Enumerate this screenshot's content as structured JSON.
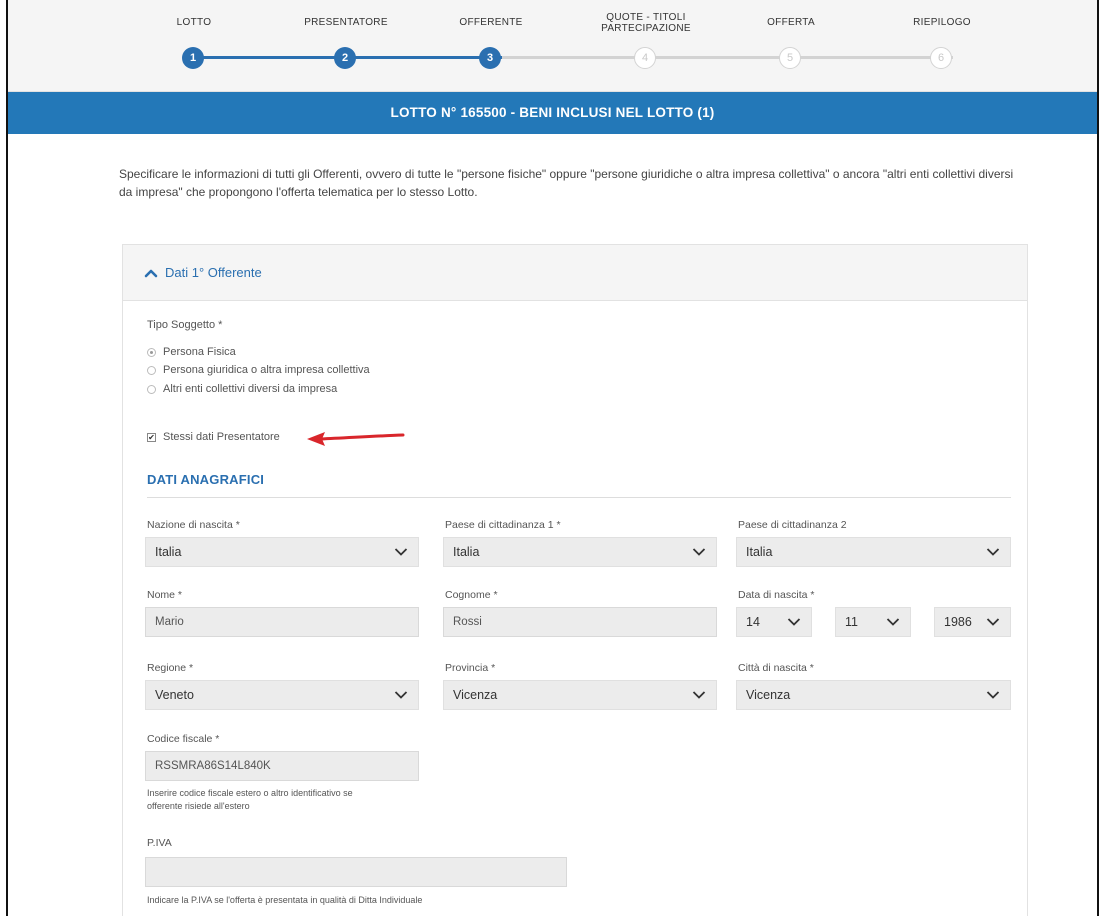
{
  "stepper": {
    "steps": [
      {
        "label": "LOTTO",
        "number": "1",
        "state": "done"
      },
      {
        "label": "PRESENTATORE",
        "number": "2",
        "state": "done"
      },
      {
        "label": "OFFERENTE",
        "number": "3",
        "state": "done"
      },
      {
        "label_line1": "QUOTE - TITOLI",
        "label_line2": "PARTECIPAZIONE",
        "number": "4",
        "state": "todo"
      },
      {
        "label": "OFFERTA",
        "number": "5",
        "state": "todo"
      },
      {
        "label": "RIEPILOGO",
        "number": "6",
        "state": "todo"
      }
    ],
    "active_color": "#2a6fb0",
    "inactive_color": "#d3d3d3"
  },
  "banner": {
    "text": "LOTTO N° 165500  -  BENI INCLUSI NEL LOTTO  (1)",
    "color": "#2378b8"
  },
  "intro": {
    "text": "Specificare le informazioni di tutti gli Offerenti, ovvero di tutte le \"persone fisiche\" oppure \"persone giuridiche o altra impresa collettiva\" o ancora \"altri enti collettivi diversi da impresa\" che propongono l'offerta telematica per lo stesso Lotto."
  },
  "panel": {
    "title": "Dati 1° Offerente",
    "icon": "chevron-up-icon"
  },
  "tipo_soggetto": {
    "label": "Tipo Soggetto *",
    "options": [
      {
        "label": "Persona Fisica",
        "selected": true
      },
      {
        "label": "Persona giuridica o altra impresa collettiva",
        "selected": false
      },
      {
        "label": "Altri enti collettivi diversi da impresa",
        "selected": false
      }
    ]
  },
  "stessi_dati": {
    "label": "Stessi dati Presentatore",
    "checked": true
  },
  "annotation": {
    "icon": "red-arrow-icon",
    "color": "#d9262b"
  },
  "anagrafici": {
    "title": "DATI ANAGRAFICI",
    "nazione_nascita": {
      "label": "Nazione di nascita  *",
      "value": "Italia"
    },
    "paese_cittadinanza_1": {
      "label": "Paese di cittadinanza 1  *",
      "value": "Italia"
    },
    "paese_cittadinanza_2": {
      "label": "Paese di cittadinanza 2",
      "value": "Italia"
    },
    "nome": {
      "label": "Nome *",
      "value": "Mario"
    },
    "cognome": {
      "label": "Cognome *",
      "value": "Rossi"
    },
    "data_nascita": {
      "label": "Data di nascita  *",
      "day": "14",
      "month": "11",
      "year": "1986"
    },
    "regione": {
      "label": "Regione  *",
      "value": "Veneto"
    },
    "provincia": {
      "label": "Provincia  *",
      "value": "Vicenza"
    },
    "citta_nascita": {
      "label": "Città di nascita  *",
      "value": "Vicenza"
    },
    "codice_fiscale": {
      "label": "Codice fiscale  *",
      "value": "RSSMRA86S14L840K",
      "hint_line1": "Inserire codice fiscale estero o altro identificativo se",
      "hint_line2": "offerente risiede all'estero"
    },
    "piva": {
      "label": "P.IVA",
      "value": "",
      "hint": "Indicare la P.IVA se l'offerta è presentata in qualità di Ditta Individuale"
    }
  }
}
